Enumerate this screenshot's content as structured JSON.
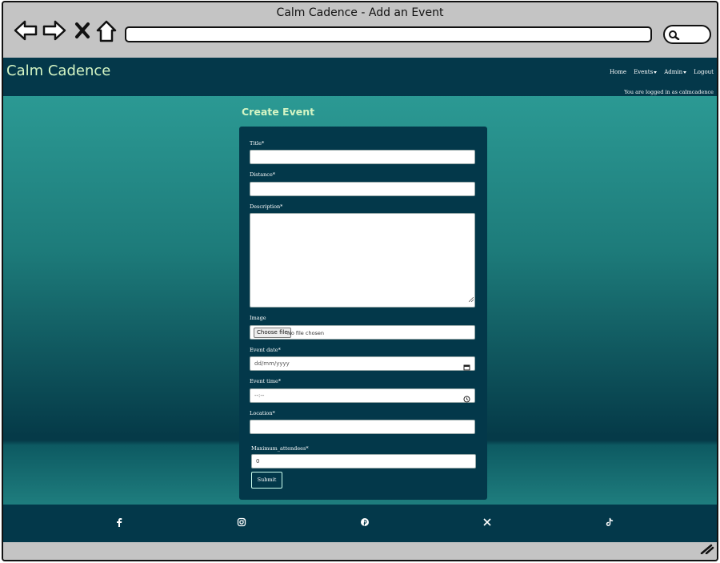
{
  "window": {
    "title": "Calm Cadence - Add an Event"
  },
  "header": {
    "brand": "Calm Cadence",
    "nav": {
      "home": "Home",
      "events": "Events",
      "admin": "Admin",
      "logout": "Logout"
    },
    "login_status": "You are logged in as calmcadence"
  },
  "page": {
    "title": "Create Event"
  },
  "form": {
    "title_label": "Title*",
    "distance_label": "Distance*",
    "description_label": "Description*",
    "image_label": "Image",
    "image_button": "Choose file",
    "image_status": "No file chosen",
    "event_date_label": "Event date*",
    "event_date_placeholder": "dd/mm/yyyy",
    "event_time_label": "Event time*",
    "event_time_placeholder": "--:--",
    "location_label": "Location*",
    "max_attendees_label": "Maximum_attendees*",
    "max_attendees_value": "0",
    "submit_label": "Submit"
  },
  "footer": {
    "social_icons": [
      "facebook-icon",
      "instagram-icon",
      "pinterest-icon",
      "x-icon",
      "tiktok-icon"
    ]
  },
  "colors": {
    "header_bg": "#04384a",
    "brand_text": "#d4f5c4",
    "gradient_top": "#2fa19a",
    "gradient_bottom": "#053a48"
  }
}
